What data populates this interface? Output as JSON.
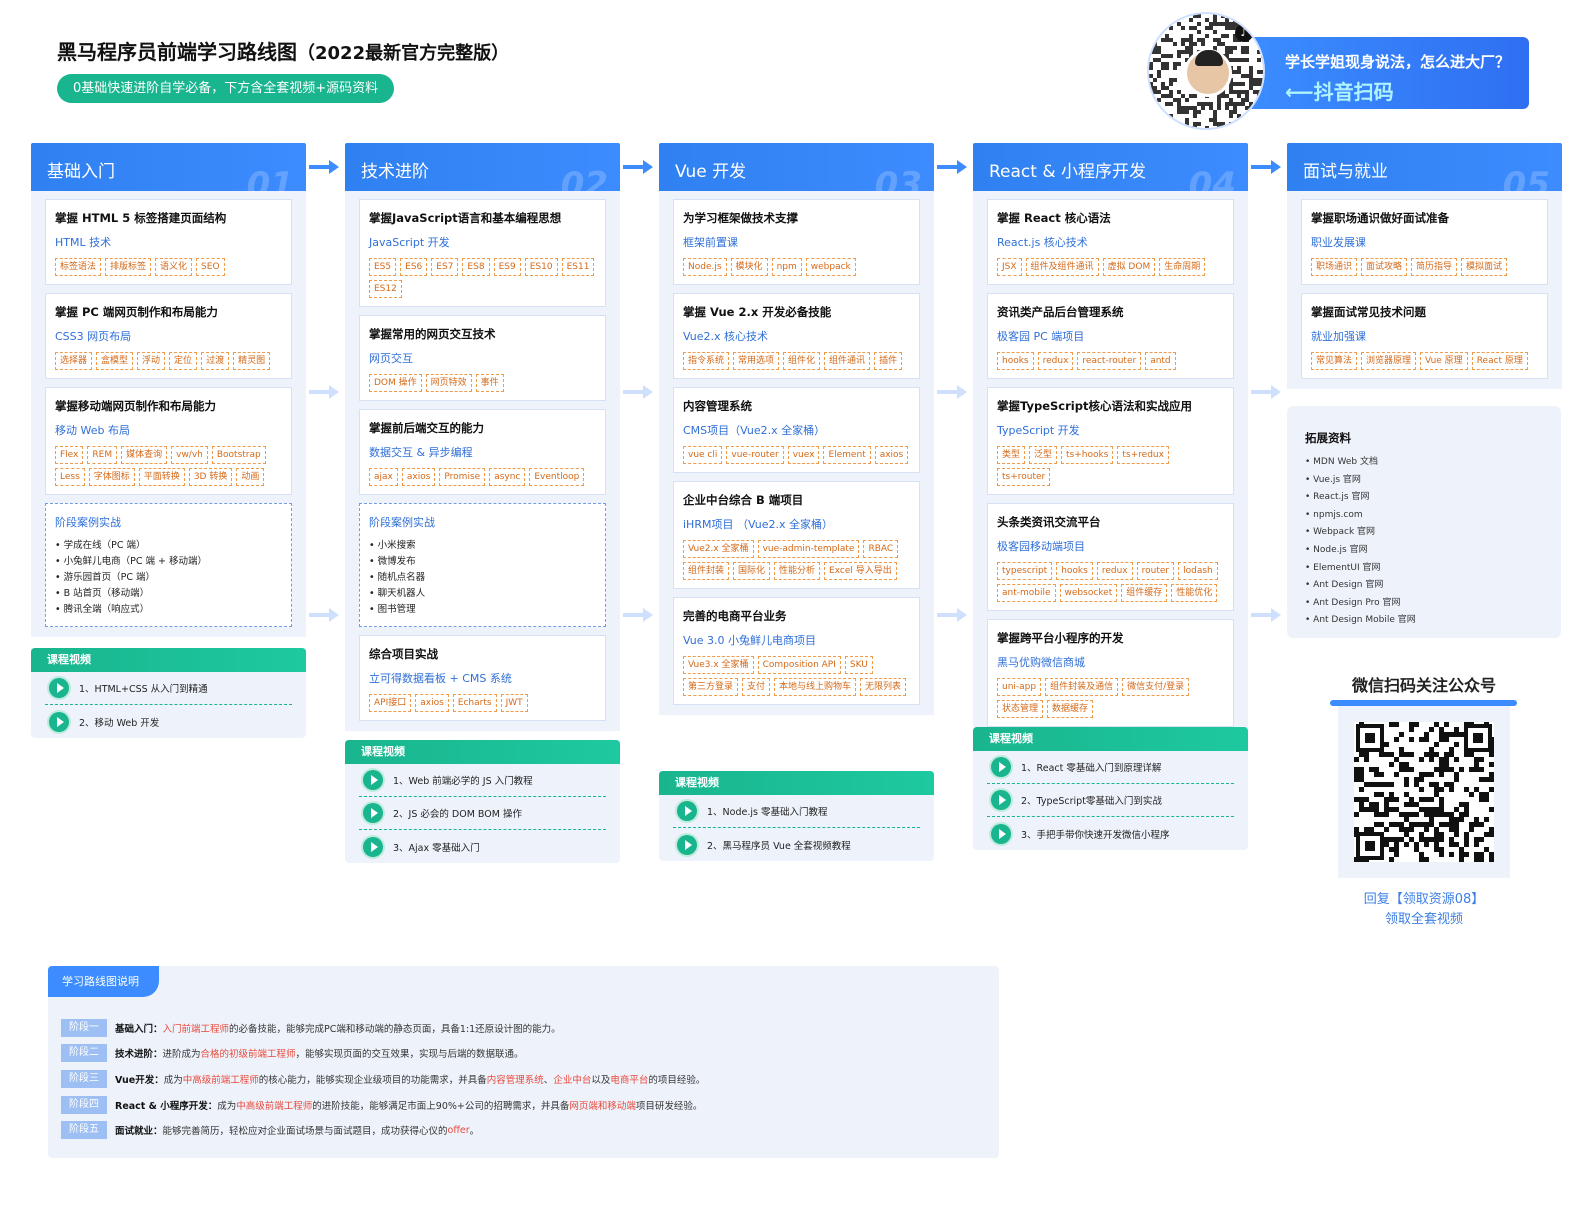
{
  "header": {
    "title": "黑马程序员前端学习路线图",
    "title_suffix": "（2022最新官方完整版）",
    "tagline": "0基础快速进阶自学必备，下方含全套视频+源码资料"
  },
  "promo": {
    "line1": "学长学姐现身说法，怎么进大厂？",
    "line2": "⟵抖音扫码"
  },
  "columns": [
    {
      "title": "基础入门",
      "num": "01",
      "cards": [
        {
          "title": "掌握 HTML 5 标签搭建页面结构",
          "sub": "HTML 技术",
          "tags": [
            "标签语法",
            "排版标签",
            "语义化",
            "SEO"
          ]
        },
        {
          "title": "掌握 PC 端网页制作和布局能力",
          "sub": "CSS3 网页布局",
          "tags": [
            "选择器",
            "盒模型",
            "浮动",
            "定位",
            "过渡",
            "精灵图"
          ]
        },
        {
          "title": "掌握移动端网页制作和布局能力",
          "sub": "移动 Web 布局",
          "tags": [
            "Flex",
            "REM",
            "媒体查询",
            "vw/vh",
            "Bootstrap",
            "Less",
            "字体图标",
            "平面转换",
            "3D 转换",
            "动画"
          ]
        }
      ],
      "case": {
        "title": "阶段案例实战",
        "items": [
          "学成在线（PC 端）",
          "小兔鲜儿电商（PC 端 + 移动端）",
          "游乐园首页（PC 端）",
          "B 站首页（移动端）",
          "腾讯全端（响应式）"
        ]
      },
      "videos": {
        "head": "课程视频",
        "items": [
          "1、HTML+CSS 从入门到精通",
          "2、移动 Web 开发"
        ]
      }
    },
    {
      "title": "技术进阶",
      "num": "02",
      "cards": [
        {
          "title": "掌握JavaScript语言和基本编程思想",
          "sub": "JavaScript 开发",
          "tags": [
            "ES5",
            "ES6",
            "ES7",
            "ES8",
            "ES9",
            "ES10",
            "ES11",
            "ES12"
          ]
        },
        {
          "title": "掌握常用的网页交互技术",
          "sub": "网页交互",
          "tags": [
            "DOM 操作",
            "网页特效",
            "事件"
          ]
        },
        {
          "title": "掌握前后端交互的能力",
          "sub": "数据交互 & 异步编程",
          "tags": [
            "ajax",
            "axios",
            "Promise",
            "async",
            "Eventloop"
          ]
        }
      ],
      "case": {
        "title": "阶段案例实战",
        "items": [
          "小米搜索",
          "微博发布",
          "随机点名器",
          "聊天机器人",
          "图书管理"
        ]
      },
      "extra_card": {
        "title": "综合项目实战",
        "sub": "立可得数据看板 + CMS 系统",
        "tags": [
          "API接口",
          "axios",
          "Echarts",
          "JWT"
        ]
      },
      "videos": {
        "head": "课程视频",
        "items": [
          "1、Web 前端必学的 JS 入门教程",
          "2、JS 必会的 DOM BOM 操作",
          "3、Ajax 零基础入门"
        ]
      }
    },
    {
      "title": "Vue 开发",
      "num": "03",
      "cards": [
        {
          "title": "为学习框架做技术支撑",
          "sub": "框架前置课",
          "tags": [
            "Node.js",
            "模块化",
            "npm",
            "webpack"
          ]
        },
        {
          "title": "掌握 Vue 2.x 开发必备技能",
          "sub": "Vue2.x 核心技术",
          "tags": [
            "指令系统",
            "常用选项",
            "组件化",
            "组件通讯",
            "插件"
          ]
        },
        {
          "title": "内容管理系统",
          "sub": "CMS项目（Vue2.x 全家桶）",
          "tags": [
            "vue cli",
            "vue-router",
            "vuex",
            "Element",
            "axios"
          ]
        },
        {
          "title": "企业中台综合 B 端项目",
          "sub": "iHRM项目 （Vue2.x 全家桶）",
          "tags": [
            "Vue2.x 全家桶",
            "vue-admin-template",
            "RBAC",
            "组件封装",
            "国际化",
            "性能分析",
            "Excel 导入导出"
          ]
        },
        {
          "title": "完善的电商平台业务",
          "sub": "Vue 3.0 小兔鲜儿电商项目",
          "tags": [
            "Vue3.x 全家桶",
            "Composition API",
            "SKU",
            "第三方登录",
            "支付",
            "本地与线上购物车",
            "无限列表"
          ]
        }
      ],
      "videos": {
        "head": "课程视频",
        "items": [
          "1、Node.js 零基础入门教程",
          "2、黑马程序员 Vue 全套视频教程"
        ]
      }
    },
    {
      "title": "React & 小程序开发",
      "num": "04",
      "cards": [
        {
          "title": "掌握 React 核心语法",
          "sub": "React.js 核心技术",
          "tags": [
            "JSX",
            "组件及组件通讯",
            "虚拟 DOM",
            "生命周期"
          ]
        },
        {
          "title": "资讯类产品后台管理系统",
          "sub": "极客园 PC 端项目",
          "tags": [
            "hooks",
            "redux",
            "react-router",
            "antd"
          ]
        },
        {
          "title": "掌握TypeScript核心语法和实战应用",
          "sub": "TypeScript 开发",
          "tags": [
            "类型",
            "泛型",
            "ts+hooks",
            "ts+redux",
            "ts+router"
          ]
        },
        {
          "title": "头条类资讯交流平台",
          "sub": "极客园移动端项目",
          "tags": [
            "typescript",
            "hooks",
            "redux",
            "router",
            "lodash",
            "ant-mobile",
            "websocket",
            "组件缓存",
            "性能优化"
          ]
        },
        {
          "title": "掌握跨平台小程序的开发",
          "sub": "黑马优购微信商城",
          "tags": [
            "uni-app",
            "组件封装及通信",
            "微信支付/登录",
            "状态管理",
            "数据缓存"
          ]
        }
      ],
      "videos": {
        "head": "课程视频",
        "items": [
          "1、React 零基础入门到原理详解",
          "2、TypeScript零基础入门到实战",
          "3、手把手带你快速开发微信小程序"
        ]
      }
    },
    {
      "title": "面试与就业",
      "num": "05",
      "cards": [
        {
          "title": "掌握职场通识做好面试准备",
          "sub": "职业发展课",
          "tags": [
            "职场通识",
            "面试攻略",
            "简历指导",
            "模拟面试"
          ]
        },
        {
          "title": "掌握面试常见技术问题",
          "sub": "就业加强课",
          "tags": [
            "常见算法",
            "浏览器原理",
            "Vue 原理",
            "React 原理"
          ]
        }
      ]
    }
  ],
  "extension": {
    "title": "拓展资料",
    "items": [
      "MDN Web 文档",
      "Vue.js 官网",
      "React.js 官网",
      "npmjs.com",
      "Webpack 官网",
      "Node.js 官网",
      "ElementUI 官网",
      "Ant Design 官网",
      "Ant Design Pro 官网",
      "Ant Design Mobile 官网"
    ]
  },
  "wechat": {
    "title": "微信扫码关注公众号",
    "caption1": "回复【领取资源08】",
    "caption2": "领取全套视频"
  },
  "legend": {
    "head": "学习路线图说明",
    "rows": [
      {
        "badge": "阶段一",
        "label": "基础入门：",
        "parts": [
          {
            "t": "入门前端工程师",
            "r": true
          },
          {
            "t": "的必备技能，能够完成PC端和移动端的静态页面，具备1:1还原设计图的能力。",
            "r": false
          }
        ]
      },
      {
        "badge": "阶段二",
        "label": "技术进阶：",
        "parts": [
          {
            "t": "进阶成为",
            "r": false
          },
          {
            "t": "合格的初级前端工程师",
            "r": true
          },
          {
            "t": "，能够实现页面的交互效果，实现与后端的数据联通。",
            "r": false
          }
        ]
      },
      {
        "badge": "阶段三",
        "label": "Vue开发：",
        "parts": [
          {
            "t": "成为",
            "r": false
          },
          {
            "t": "中高级前端工程师",
            "r": true
          },
          {
            "t": "的核心能力，能够实现企业级项目的功能需求，并具备",
            "r": false
          },
          {
            "t": "内容管理系统",
            "r": true
          },
          {
            "t": "、",
            "r": false
          },
          {
            "t": "企业中台",
            "r": true
          },
          {
            "t": "以及",
            "r": false
          },
          {
            "t": "电商平台",
            "r": true
          },
          {
            "t": "的项目经验。",
            "r": false
          }
        ]
      },
      {
        "badge": "阶段四",
        "label": "React & 小程序开发：",
        "parts": [
          {
            "t": "成为",
            "r": false
          },
          {
            "t": "中高级前端工程师",
            "r": true
          },
          {
            "t": "的进阶技能，能够满足市面上90%+公司的招聘需求，并具备",
            "r": false
          },
          {
            "t": "网页端和移动端",
            "r": true
          },
          {
            "t": "项目研发经验。",
            "r": false
          }
        ]
      },
      {
        "badge": "阶段五",
        "label": "面试就业：",
        "parts": [
          {
            "t": "能够完善简历，轻松应对企业面试场景与面试题目，成功获得心仪的",
            "r": false
          },
          {
            "t": "offer",
            "r": true
          },
          {
            "t": "。",
            "r": false
          }
        ]
      }
    ]
  },
  "colors": {
    "primary": "#3d8cff",
    "green": "#19b58e",
    "tag": "#d46a1a",
    "red": "#e84a3c"
  }
}
